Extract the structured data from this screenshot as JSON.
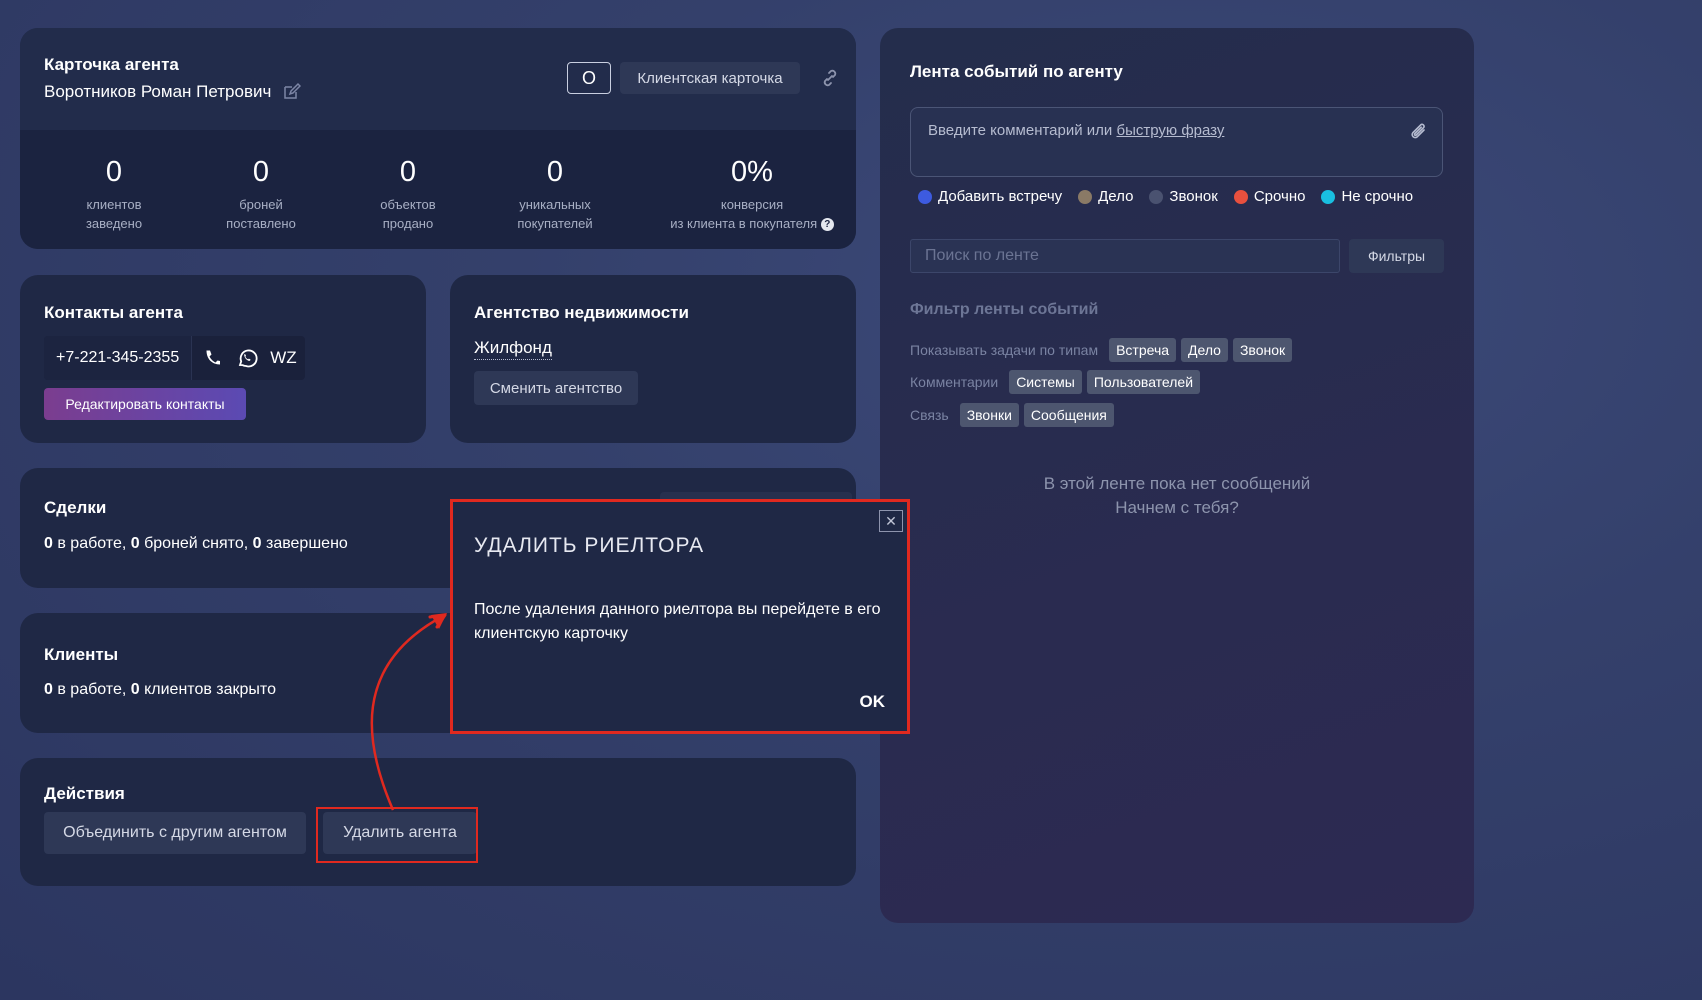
{
  "agent_card": {
    "title": "Карточка агента",
    "name": "Воротников Роман Петрович",
    "o_button": "О",
    "client_card_button": "Клиентская карточка",
    "stats": [
      {
        "value": "0",
        "label1": "клиентов",
        "label2": "заведено"
      },
      {
        "value": "0",
        "label1": "броней",
        "label2": "поставлено"
      },
      {
        "value": "0",
        "label1": "объектов",
        "label2": "продано"
      },
      {
        "value": "0",
        "label1": "уникальных",
        "label2": "покупателей"
      },
      {
        "value": "0%",
        "label1": "конверсия",
        "label2": "из клиента в покупателя"
      }
    ]
  },
  "contacts": {
    "title": "Контакты агента",
    "phone": "+7-221-345-2355",
    "wz": "WZ",
    "edit_button": "Редактировать контакты"
  },
  "agency": {
    "title": "Агентство недвижимости",
    "name": "Жилфонд",
    "change_button": "Сменить агентство"
  },
  "deals": {
    "title": "Сделки",
    "in_work": "0",
    "in_work_text": " в работе, ",
    "cancelled": "0",
    "cancelled_text": " броней снято, ",
    "completed": "0",
    "completed_text": " завершено"
  },
  "clients": {
    "title": "Клиенты",
    "in_work": "0",
    "in_work_text": " в работе, ",
    "closed": "0",
    "closed_text": " клиентов закрыто"
  },
  "actions": {
    "title": "Действия",
    "merge_button": "Объединить с другим агентом",
    "delete_button": "Удалить агента"
  },
  "feed": {
    "title": "Лента событий по агенту",
    "comment_placeholder_prefix": "Введите комментарий или ",
    "comment_placeholder_link": "быструю фразу",
    "tags": [
      {
        "label": "Добавить встречу",
        "color": "#3d5be0"
      },
      {
        "label": "Дело",
        "color": "#8a7a66"
      },
      {
        "label": "Звонок",
        "color": "#4a5270"
      },
      {
        "label": "Срочно",
        "color": "#e8503e"
      },
      {
        "label": "Не срочно",
        "color": "#19bfe0"
      }
    ],
    "search_placeholder": "Поиск по ленте",
    "filters_button": "Фильтры",
    "filter_heading": "Фильтр ленты событий",
    "filter_rows": [
      {
        "label": "Показывать задачи по типам",
        "chips": [
          "Встреча",
          "Дело",
          "Звонок"
        ]
      },
      {
        "label": "Комментарии",
        "chips": [
          "Системы",
          "Пользователей"
        ]
      },
      {
        "label": "Связь",
        "chips": [
          "Звонки",
          "Сообщения"
        ]
      }
    ],
    "empty_line1": "В этой ленте пока нет сообщений",
    "empty_line2": "Начнем с тебя?"
  },
  "modal": {
    "title": "УДАЛИТЬ РИЕЛТОРА",
    "body": "После удаления данного риелтора вы перейдете в его клиентскую карточку",
    "ok": "OK",
    "close": "✕"
  },
  "colors": {
    "highlight": "#e0291f",
    "card": "#1f2845",
    "accent_gradient_start": "#7b3d8f",
    "accent_gradient_end": "#5b4ab3"
  }
}
